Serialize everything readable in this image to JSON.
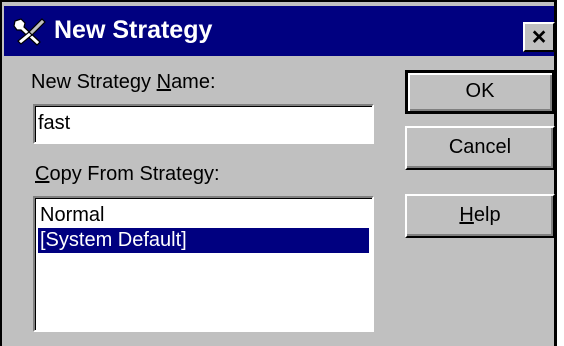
{
  "window": {
    "title": "New Strategy",
    "close_glyph": "×",
    "icon": "wrench-screwdriver-icon"
  },
  "form": {
    "name_label_pre": "New Strategy ",
    "name_label_ul": "N",
    "name_label_post": "ame:",
    "name_value": "fast",
    "copy_label_ul": "C",
    "copy_label_post": "opy From Strategy:",
    "strategies": [
      {
        "label": "Normal",
        "selected": false
      },
      {
        "label": "[System Default]",
        "selected": true
      }
    ]
  },
  "buttons": {
    "ok_label": "OK",
    "cancel_label": "Cancel",
    "help_label_ul": "H",
    "help_label_post": "elp"
  },
  "colors": {
    "titlebar": "#000080",
    "face": "#c0c0c0",
    "selection": "#000080"
  }
}
